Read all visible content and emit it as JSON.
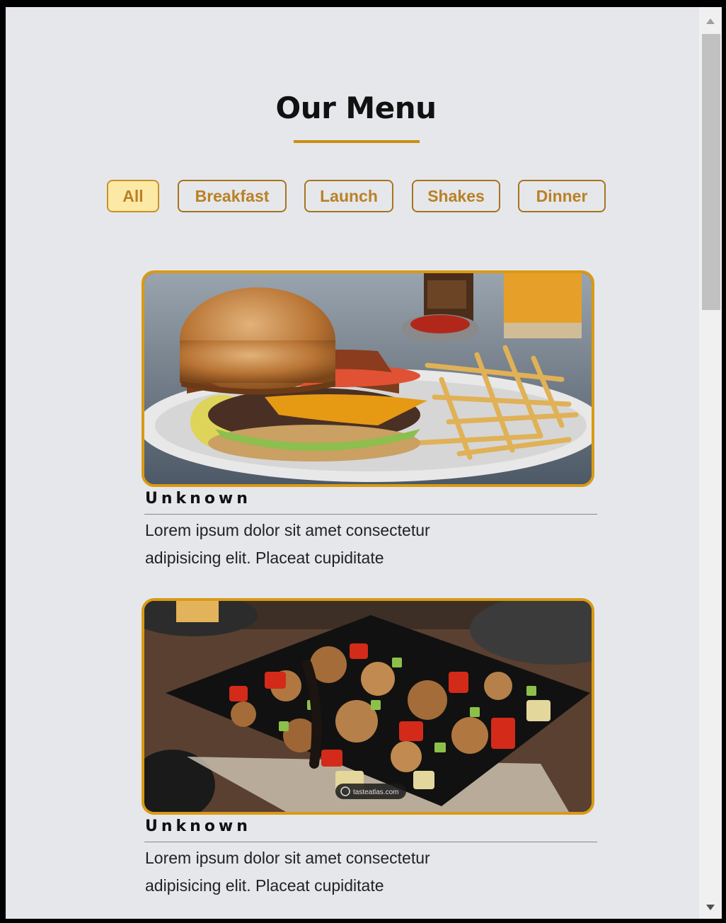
{
  "header": {
    "title": "Our Menu"
  },
  "filters": [
    {
      "label": "All",
      "active": true
    },
    {
      "label": "Breakfast",
      "active": false
    },
    {
      "label": "Launch",
      "active": false
    },
    {
      "label": "Shakes",
      "active": false
    },
    {
      "label": "Dinner",
      "active": false
    }
  ],
  "menu_items": [
    {
      "title": "Unknown",
      "description": "Lorem ipsum dolor sit amet consectetur adipisicing elit. Placeat cupiditate",
      "image": "burger-with-fries"
    },
    {
      "title": "Unknown",
      "description": "Lorem ipsum dolor sit amet consectetur adipisicing elit. Placeat cupiditate",
      "image": "kung-pao-chicken",
      "image_watermark": "tasteatlas.com"
    }
  ],
  "colors": {
    "accent": "#cc8d12",
    "active_filter_bg": "#fde9a6",
    "page_bg": "#e5e7eb"
  }
}
